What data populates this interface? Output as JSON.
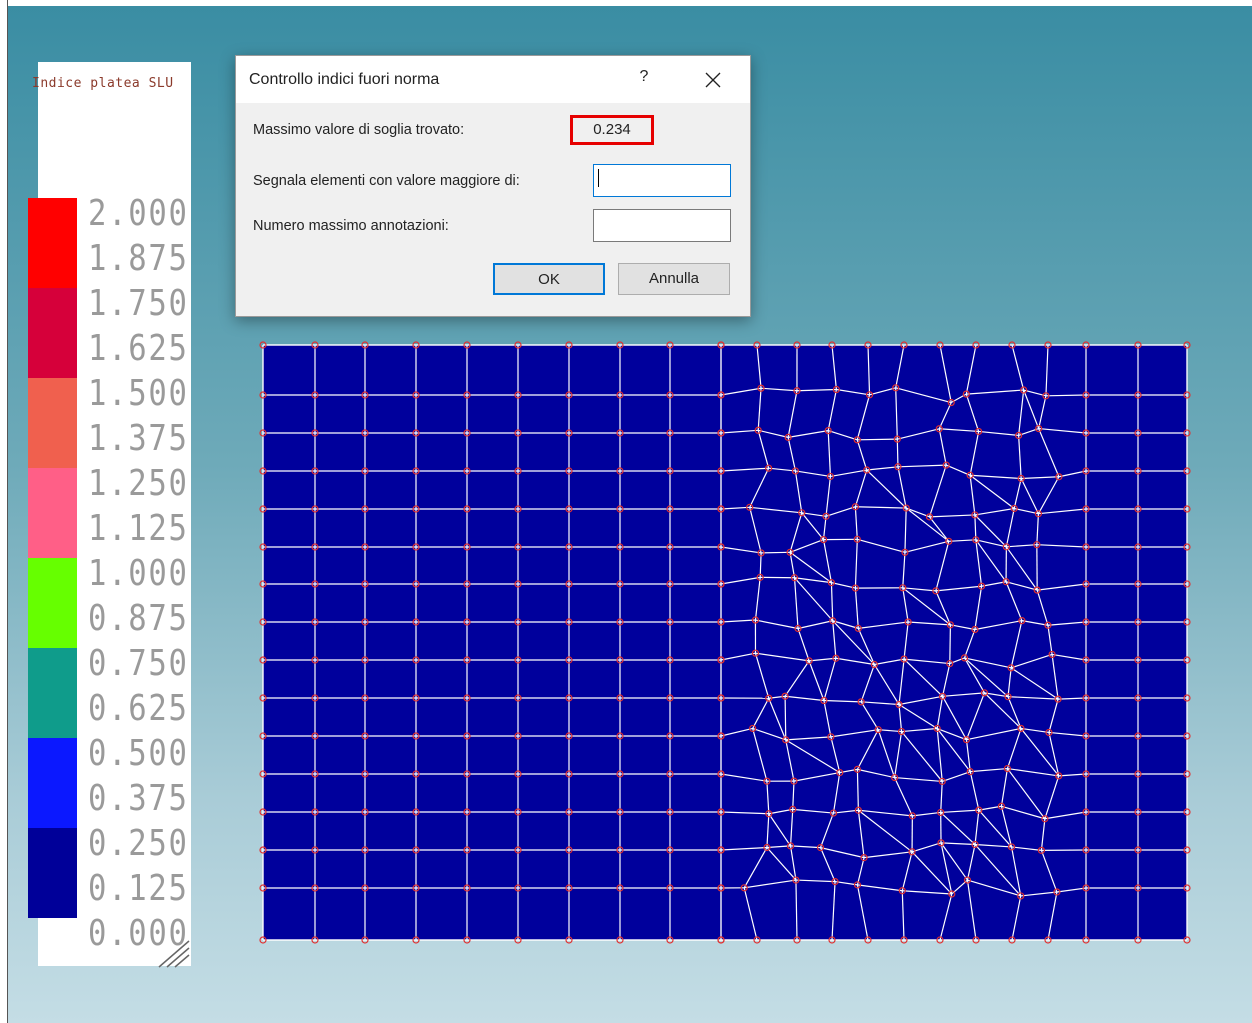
{
  "legend": {
    "title": "Indice platea SLU",
    "ticks": [
      "2.000",
      "1.875",
      "1.750",
      "1.625",
      "1.500",
      "1.375",
      "1.250",
      "1.125",
      "1.000",
      "0.875",
      "0.750",
      "0.625",
      "0.500",
      "0.375",
      "0.250",
      "0.125",
      "0.000"
    ],
    "bands": [
      {
        "color": "#ff0000"
      },
      {
        "color": "#d6003a"
      },
      {
        "color": "#f0604e"
      },
      {
        "color": "#ff5f87"
      },
      {
        "color": "#66ff00"
      },
      {
        "color": "#0f9c8b"
      },
      {
        "color": "#0b18ff"
      },
      {
        "color": "#000099"
      }
    ]
  },
  "dialog": {
    "title": "Controllo indici fuori norma",
    "help_label": "?",
    "max_threshold_label": "Massimo valore di soglia trovato:",
    "max_threshold_value": "0.234",
    "flag_elements_label": "Segnala elementi con valore maggiore di:",
    "flag_elements_value": "",
    "max_annotations_label": "Numero massimo annotazioni:",
    "max_annotations_value": "",
    "ok_label": "OK",
    "cancel_label": "Annulla"
  },
  "mesh": {
    "fill_color": "#00009c",
    "line_color": "#ffffff",
    "node_color": "#e03030"
  }
}
